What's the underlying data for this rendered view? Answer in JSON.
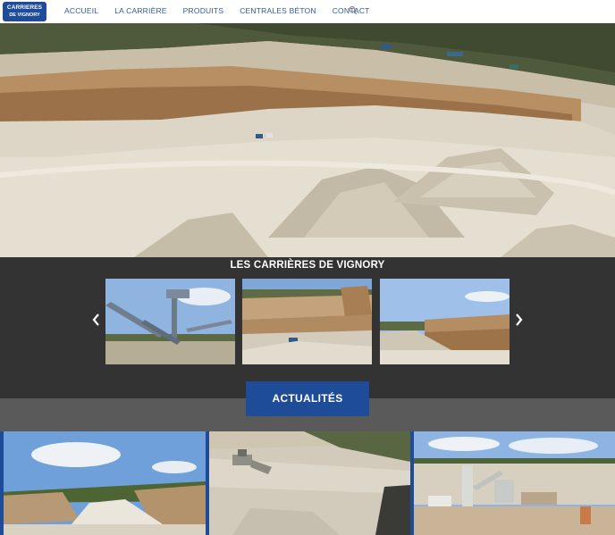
{
  "brand": {
    "logo_line1": "CARRIERES",
    "logo_line2": "DE VIGNORY",
    "accent": "#1f4c99"
  },
  "nav": {
    "items": [
      {
        "label": "ACCUEIL"
      },
      {
        "label": "LA CARRIÈRE"
      },
      {
        "label": "PRODUITS"
      },
      {
        "label": "CENTRALES BÉTON"
      },
      {
        "label": "CONTACT"
      }
    ],
    "search_icon": "search-icon"
  },
  "gallery": {
    "title": "LES CARRIÈRES DE VIGNORY",
    "prev_icon": "chevron-left-icon",
    "next_icon": "chevron-right-icon",
    "thumbs": [
      "crusher-conveyor",
      "quarry-pit",
      "quarry-cliff"
    ]
  },
  "news": {
    "button_label": "ACTUALITÉS",
    "cards": [
      "quarry-road",
      "bulldozer",
      "concrete-plant"
    ]
  }
}
